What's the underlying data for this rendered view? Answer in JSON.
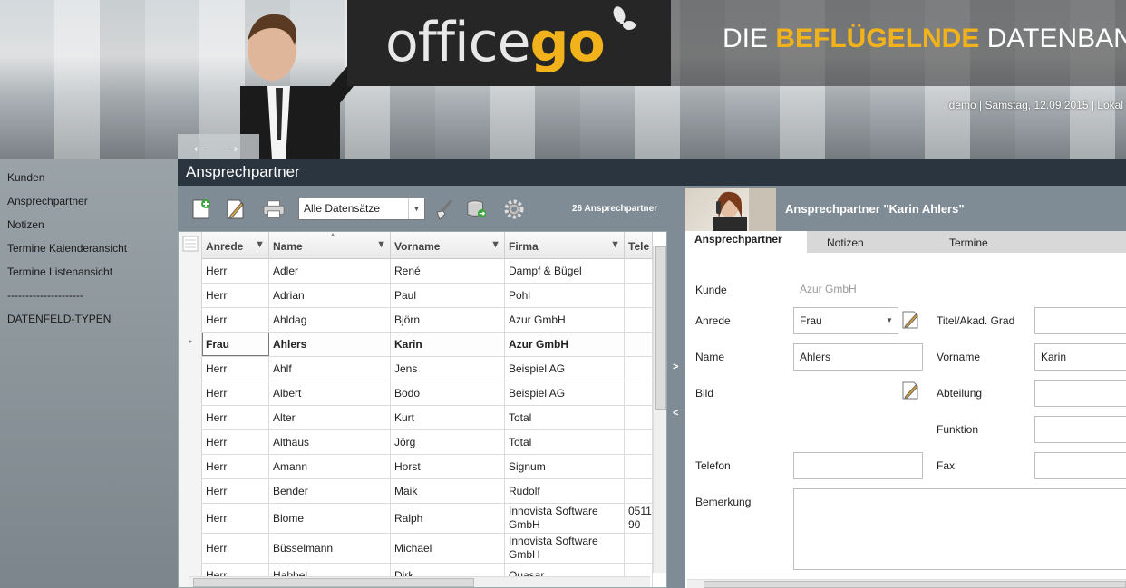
{
  "header": {
    "logo_office": "office",
    "logo_go": "go",
    "tagline_pre": "DIE ",
    "tagline_hl": "BEFLÜGELNDE",
    "tagline_post": " DATENBANK-LÖSU",
    "status": "demo | Samstag, 12.09.2015 | Lokal",
    "back_icon": "back-arrow-icon",
    "forward_icon": "forward-arrow-icon"
  },
  "sidebar": {
    "items": [
      {
        "label": "Kunden"
      },
      {
        "label": "Ansprechpartner"
      },
      {
        "label": "Notizen"
      },
      {
        "label": "Termine Kalenderansicht"
      },
      {
        "label": "Termine Listenansicht"
      },
      {
        "label": "---------------------"
      },
      {
        "label": "DATENFELD-TYPEN"
      }
    ]
  },
  "page": {
    "title": "Ansprechpartner"
  },
  "toolbar": {
    "filter_value": "Alle Datensätze",
    "record_count": "26 Ansprechpartner",
    "icons": [
      "new-record-icon",
      "edit-icon",
      "print-icon",
      "broom-icon",
      "database-sync-icon",
      "settings-gear-icon"
    ]
  },
  "grid": {
    "columns": [
      "Anrede",
      "Name",
      "Vorname",
      "Firma",
      "Tele"
    ],
    "rows": [
      [
        "Herr",
        "Adler",
        "René",
        "Dampf & Bügel",
        ""
      ],
      [
        "Herr",
        "Adrian",
        "Paul",
        "Pohl",
        ""
      ],
      [
        "Herr",
        "Ahldag",
        "Björn",
        "Azur GmbH",
        ""
      ],
      [
        "Frau",
        "Ahlers",
        "Karin",
        "Azur GmbH",
        ""
      ],
      [
        "Herr",
        "Ahlf",
        "Jens",
        "Beispiel AG",
        ""
      ],
      [
        "Herr",
        "Albert",
        "Bodo",
        "Beispiel AG",
        ""
      ],
      [
        "Herr",
        "Alter",
        "Kurt",
        "Total",
        ""
      ],
      [
        "Herr",
        "Althaus",
        "Jörg",
        "Total",
        ""
      ],
      [
        "Herr",
        "Amann",
        "Horst",
        "Signum",
        ""
      ],
      [
        "Herr",
        "Bender",
        "Maik",
        "Rudolf",
        ""
      ],
      [
        "Herr",
        "Blome",
        "Ralph",
        "Innovista Software GmbH",
        "0511 90"
      ],
      [
        "Herr",
        "Büsselmann",
        "Michael",
        "Innovista Software GmbH",
        ""
      ],
      [
        "Herr",
        "Habbel",
        "Dirk",
        "Quasar",
        ""
      ]
    ]
  },
  "detail": {
    "title": "Ansprechpartner \"Karin Ahlers\"",
    "tabs": [
      "Ansprechpartner",
      "Notizen",
      "Termine"
    ],
    "labels": {
      "kunde": "Kunde",
      "anrede": "Anrede",
      "titel": "Titel/Akad. Grad",
      "name": "Name",
      "vorname": "Vorname",
      "bild": "Bild",
      "abteilung": "Abteilung",
      "funktion": "Funktion",
      "telefon": "Telefon",
      "fax": "Fax",
      "bemerkung": "Bemerkung"
    },
    "values": {
      "kunde": "Azur GmbH",
      "anrede": "Frau",
      "titel": "",
      "name": "Ahlers",
      "vorname": "Karin",
      "abteilung": "",
      "funktion": "",
      "telefon": "",
      "fax": "",
      "bemerkung": ""
    }
  },
  "colors": {
    "accent": "#f2b21b",
    "titlebar": "#2a3540",
    "panel": "#7f8c95"
  }
}
